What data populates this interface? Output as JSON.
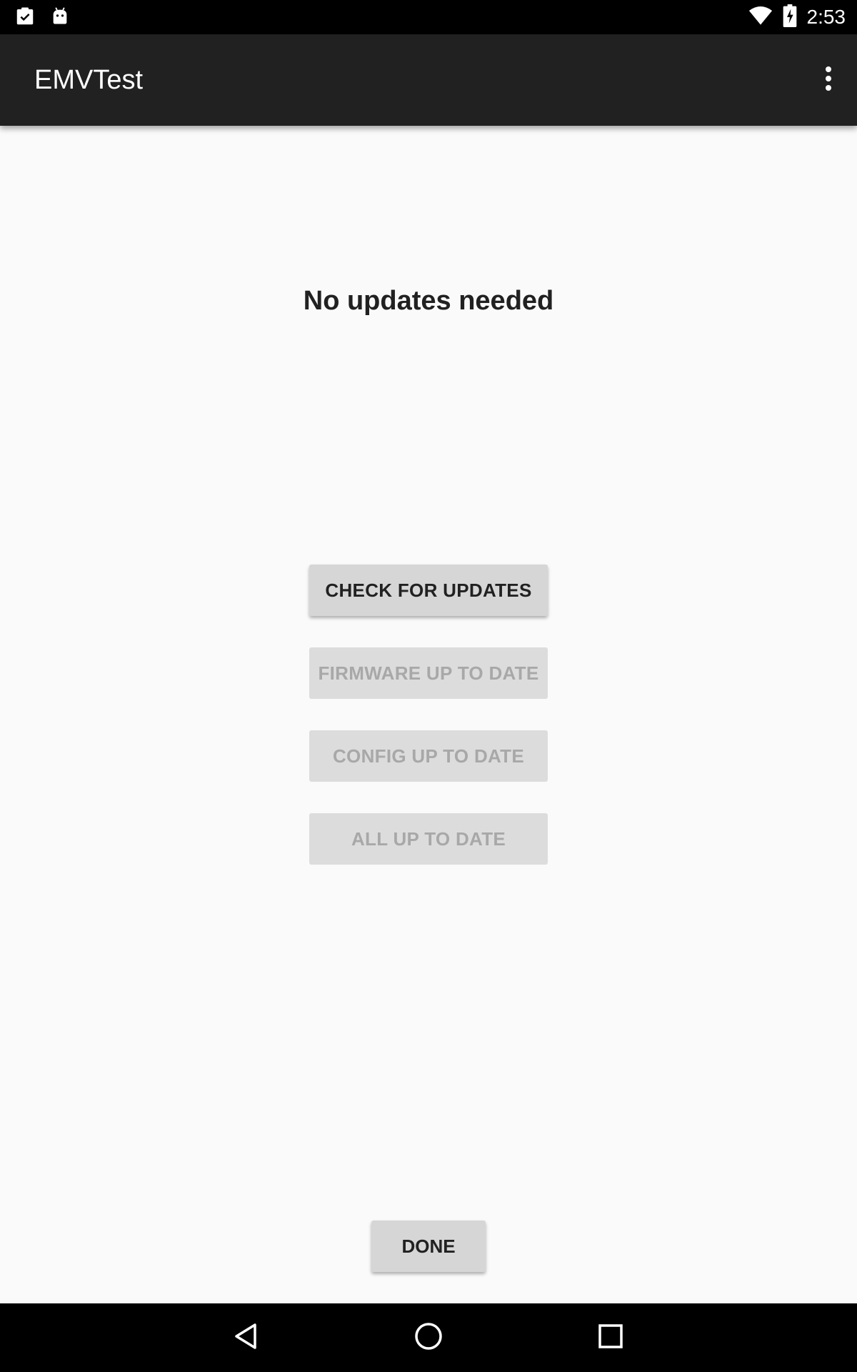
{
  "status_bar": {
    "time": "2:53",
    "left_icons": [
      "clipboard-check-icon",
      "android-icon"
    ],
    "right_icons": [
      "wifi-icon",
      "battery-charging-icon"
    ]
  },
  "app_bar": {
    "title": "EMVTest",
    "overflow_icon": "more-vert-icon"
  },
  "main": {
    "status_message": "No updates needed",
    "buttons": {
      "check": "CHECK FOR UPDATES",
      "firmware": "FIRMWARE UP TO DATE",
      "config": "CONFIG UP TO DATE",
      "all": "ALL UP TO DATE"
    },
    "done": "DONE"
  },
  "nav_bar": {
    "icons": [
      "back-icon",
      "home-icon",
      "recents-icon"
    ]
  },
  "colors": {
    "status_bar": "#000000",
    "app_bar": "#212121",
    "background": "#fafafa",
    "button": "#d6d6d6",
    "button_text_enabled": "#212121",
    "button_text_disabled": "#a8a8a8"
  }
}
